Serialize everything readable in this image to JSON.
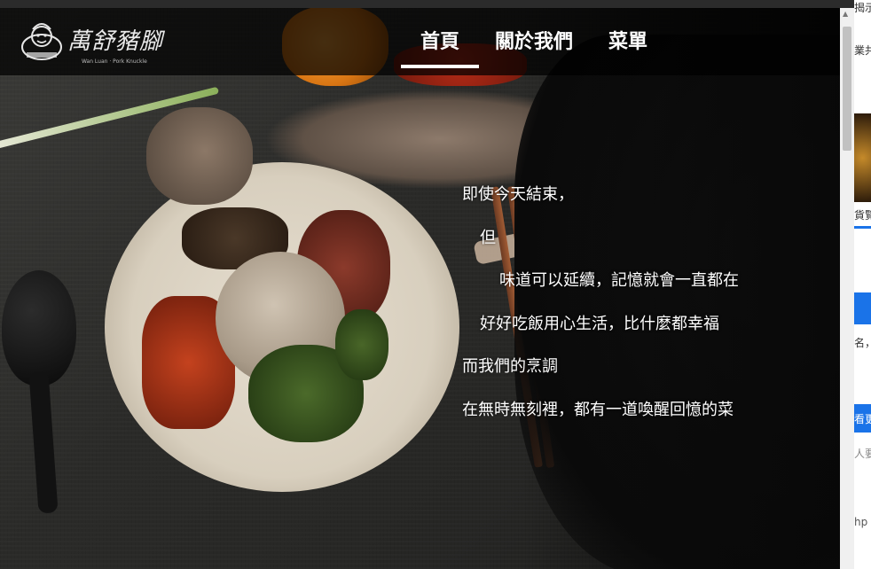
{
  "header": {
    "logo_text": "萬舒豬腳",
    "logo_sub": "Wan Luan · Pork Knuckle",
    "nav": [
      {
        "label": "首頁",
        "active": true
      },
      {
        "label": "關於我們",
        "active": false
      },
      {
        "label": "菜單",
        "active": false
      }
    ]
  },
  "hero": {
    "lines": [
      "即使今天結束，",
      "但",
      "味道可以延續，記憶就會一直都在",
      "好好吃飯用心生活，比什麼都幸福",
      "而我們的烹調",
      "在無時無刻裡，都有一道喚醒回憶的菜"
    ]
  },
  "side_panel": {
    "snippets": [
      "揭示",
      "業共",
      "貨覽",
      "名，",
      "看更",
      "人要",
      "hp"
    ]
  },
  "colors": {
    "header_bg": "#000000",
    "text": "#ffffff",
    "accent_blue": "#1a73e8"
  }
}
